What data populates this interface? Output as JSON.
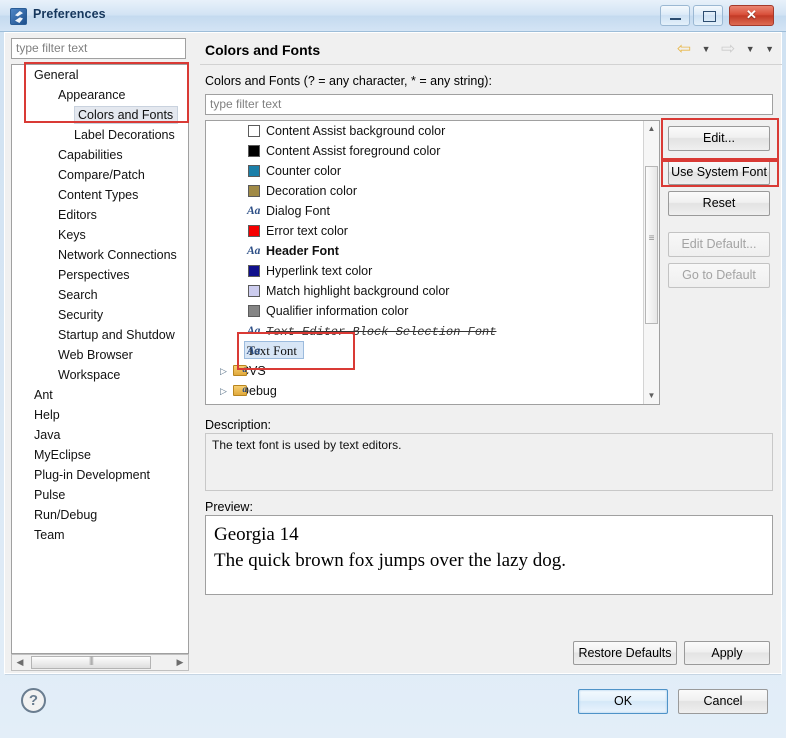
{
  "window": {
    "title": "Preferences",
    "icon": "eclipse-logo-icon",
    "minimize_label": "",
    "maximize_label": "",
    "close_label": ""
  },
  "sidebar": {
    "filter_placeholder": "type filter text",
    "filter_value": "",
    "items": [
      {
        "label": "General",
        "level": 0,
        "selected": false
      },
      {
        "label": "Appearance",
        "level": 1,
        "selected": false
      },
      {
        "label": "Colors and Fonts",
        "level": 2,
        "selected": true
      },
      {
        "label": "Label Decorations",
        "level": 2,
        "selected": false
      },
      {
        "label": "Capabilities",
        "level": 1,
        "selected": false
      },
      {
        "label": "Compare/Patch",
        "level": 1,
        "selected": false
      },
      {
        "label": "Content Types",
        "level": 1,
        "selected": false
      },
      {
        "label": "Editors",
        "level": 1,
        "selected": false
      },
      {
        "label": "Keys",
        "level": 1,
        "selected": false
      },
      {
        "label": "Network Connections",
        "level": 1,
        "selected": false
      },
      {
        "label": "Perspectives",
        "level": 1,
        "selected": false
      },
      {
        "label": "Search",
        "level": 1,
        "selected": false
      },
      {
        "label": "Security",
        "level": 1,
        "selected": false
      },
      {
        "label": "Startup and Shutdow",
        "level": 1,
        "selected": false
      },
      {
        "label": "Web Browser",
        "level": 1,
        "selected": false
      },
      {
        "label": "Workspace",
        "level": 1,
        "selected": false
      },
      {
        "label": "Ant",
        "level": 0,
        "selected": false
      },
      {
        "label": "Help",
        "level": 0,
        "selected": false
      },
      {
        "label": "Java",
        "level": 0,
        "selected": false
      },
      {
        "label": "MyEclipse",
        "level": 0,
        "selected": false
      },
      {
        "label": "Plug-in Development",
        "level": 0,
        "selected": false
      },
      {
        "label": "Pulse",
        "level": 0,
        "selected": false
      },
      {
        "label": "Run/Debug",
        "level": 0,
        "selected": false
      },
      {
        "label": "Team",
        "level": 0,
        "selected": false
      }
    ]
  },
  "main": {
    "title": "Colors and Fonts",
    "nav": {
      "back_icon": "arrow-left-icon",
      "back_menu_icon": "chevron-down-icon",
      "forward_icon": "arrow-right-icon",
      "forward_menu_icon": "chevron-down-icon",
      "view_menu_icon": "chevron-down-icon"
    },
    "filter_label": "Colors and Fonts (? = any character, * = any string):",
    "filter_placeholder": "type filter text",
    "filter_value": "",
    "list": [
      {
        "label": "Content Assist background color",
        "kind": "color",
        "color": "#ffffff",
        "style": "normal"
      },
      {
        "label": "Content Assist foreground color",
        "kind": "color",
        "color": "#000000",
        "style": "normal"
      },
      {
        "label": "Counter color",
        "kind": "color",
        "color": "#1b7fa8",
        "style": "normal"
      },
      {
        "label": "Decoration color",
        "kind": "color",
        "color": "#a08a46",
        "style": "normal"
      },
      {
        "label": "Dialog Font",
        "kind": "font",
        "style": "normal"
      },
      {
        "label": "Error text color",
        "kind": "color",
        "color": "#f50000",
        "style": "normal"
      },
      {
        "label": "Header Font",
        "kind": "font",
        "style": "bold"
      },
      {
        "label": "Hyperlink text color",
        "kind": "color",
        "color": "#10108c",
        "style": "normal"
      },
      {
        "label": "Match highlight background color",
        "kind": "color",
        "color": "#ccccee",
        "style": "normal"
      },
      {
        "label": "Qualifier information color",
        "kind": "color",
        "color": "#858585",
        "style": "normal"
      },
      {
        "label": "Text Editor Block Selection Font",
        "kind": "font",
        "style": "strikethrough"
      },
      {
        "label": "Text Font",
        "kind": "font",
        "style": "selected"
      },
      {
        "label": "CVS",
        "kind": "group",
        "expander": "collapsed"
      },
      {
        "label": "Debug",
        "kind": "group",
        "expander": "collapsed"
      }
    ],
    "buttons": {
      "edit": "Edit...",
      "use_system_font": "Use System Font",
      "reset": "Reset",
      "edit_default": "Edit Default...",
      "go_to_default": "Go to Default"
    },
    "description_label": "Description:",
    "description_text": "The text font is used by text editors.",
    "preview_label": "Preview:",
    "preview_line1": "Georgia 14",
    "preview_line2": "The quick brown fox jumps over the lazy dog."
  },
  "footer": {
    "restore_defaults": "Restore Defaults",
    "apply": "Apply",
    "ok": "OK",
    "cancel": "Cancel",
    "help_icon": "question-mark-icon"
  },
  "scrollbars": {
    "left_arrow_icon": "triangle-left-icon",
    "right_arrow_icon": "triangle-right-icon",
    "up_arrow_icon": "triangle-up-icon",
    "down_arrow_icon": "triangle-down-icon"
  },
  "annotations": {
    "accent_color": "#d93a35",
    "boxes": [
      "tree-general-branch",
      "edit-button",
      "use-system-font-button",
      "text-font-row"
    ]
  }
}
